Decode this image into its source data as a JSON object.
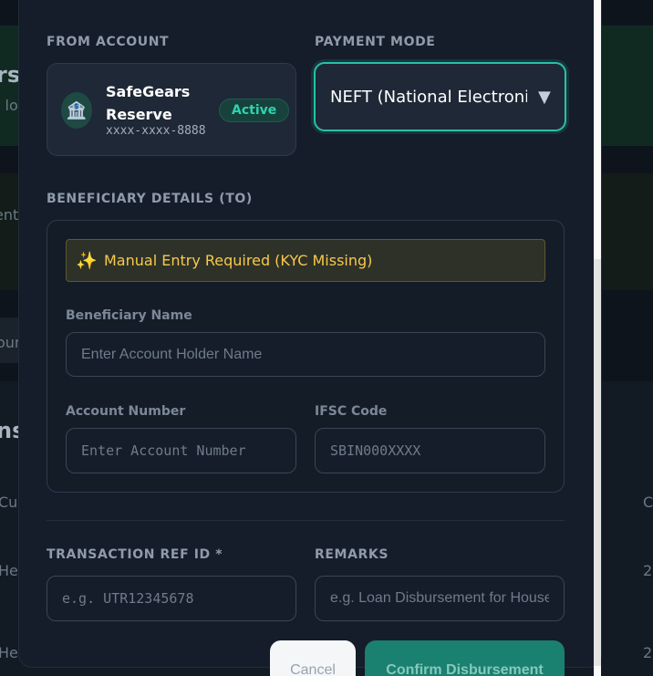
{
  "background": {
    "fragments": [
      "rs",
      "l lo",
      "ent",
      "our",
      "ns",
      "Cu",
      "He",
      "He",
      "C",
      "2",
      "2"
    ]
  },
  "from_account": {
    "label": "FROM ACCOUNT",
    "name": "SafeGears Reserve",
    "masked_number": "xxxx-xxxx-8888",
    "status": "Active",
    "icon": "bank-icon"
  },
  "payment_mode": {
    "label": "PAYMENT MODE",
    "selected": "NEFT (National Electronic Funds Transfer)"
  },
  "beneficiary": {
    "section_label": "BENEFICIARY DETAILS (TO)",
    "alert": "Manual Entry Required (KYC Missing)",
    "name_label": "Beneficiary Name",
    "name_placeholder": "Enter Account Holder Name",
    "account_label": "Account Number",
    "account_placeholder": "Enter Account Number",
    "ifsc_label": "IFSC Code",
    "ifsc_placeholder": "SBIN000XXXX"
  },
  "transaction": {
    "ref_label": "TRANSACTION REF ID *",
    "ref_placeholder": "e.g. UTR12345678",
    "remarks_label": "REMARKS",
    "remarks_placeholder": "e.g. Loan Disbursement for House"
  },
  "actions": {
    "cancel": "Cancel",
    "confirm": "Confirm Disbursement"
  },
  "colors": {
    "accent": "#27c2a5",
    "warning": "#f7c94a"
  }
}
